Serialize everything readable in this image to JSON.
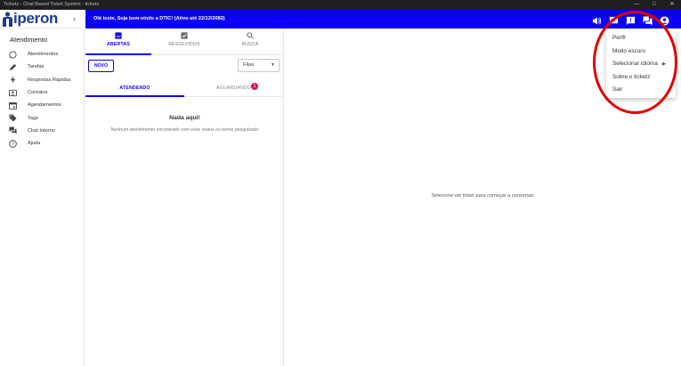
{
  "window": {
    "title": "Ticketz - Chat Based Ticket System - ticketz"
  },
  "brand": {
    "logo_text": "iperon"
  },
  "sidebar": {
    "section_title": "Atendimento",
    "items": [
      {
        "label": "Atendimentos",
        "icon": "whatsapp-icon"
      },
      {
        "label": "Tarefas",
        "icon": "pencil-icon"
      },
      {
        "label": "Respostas Rápidas",
        "icon": "bolt-icon"
      },
      {
        "label": "Contatos",
        "icon": "contacts-icon"
      },
      {
        "label": "Agendamentos",
        "icon": "calendar-icon"
      },
      {
        "label": "Tags",
        "icon": "tag-icon"
      },
      {
        "label": "Chat Interno",
        "icon": "forum-icon"
      },
      {
        "label": "Ajuda",
        "icon": "help-icon"
      }
    ]
  },
  "topbar": {
    "welcome": "Olá teste, Seja bem-vindo a DTIC! (Ativo até 22/12/2082)"
  },
  "tickets": {
    "tabs": [
      {
        "label": "ABERTAS",
        "icon": "inbox-icon"
      },
      {
        "label": "RESOLVIDOS",
        "icon": "check-box-icon"
      },
      {
        "label": "BUSCA",
        "icon": "search-icon"
      }
    ],
    "new_label": "NOVO",
    "queue_select": "Filas",
    "subtabs": [
      {
        "label": "ATENDENDO"
      },
      {
        "label": "AGUARDANDO"
      }
    ],
    "waiting_badge": "1",
    "empty_title": "Nada aqui!",
    "empty_message": "Nenhum atendimento encontrado com esse status ou termo pesquisado"
  },
  "main": {
    "placeholder": "Selecione um ticket para começar a conversar."
  },
  "user_menu": {
    "items": [
      {
        "label": "Perfil"
      },
      {
        "label": "Modo escuro"
      },
      {
        "label": "Selecionar idioma"
      },
      {
        "label": "Sobre o ticketz"
      },
      {
        "label": "Sair"
      }
    ]
  },
  "colors": {
    "primary": "#0c00f5",
    "badge": "#e0115f",
    "annotation": "#e00000"
  }
}
